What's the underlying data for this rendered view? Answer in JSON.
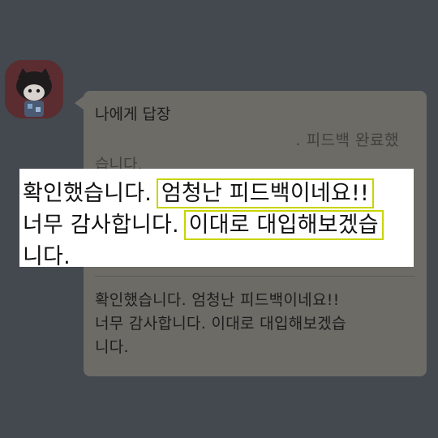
{
  "chat": {
    "reply_title": "나에게 답장",
    "quoted_line1": ". 피드백 완료했",
    "quoted_line2": "습니다.",
    "reply_lines": [
      "확인했습니다. 엄청난 피드백이네요!!",
      "너무 감사합니다. 이대로 대입해보겠습",
      "니다."
    ]
  },
  "zoom": {
    "line1_plain": "확인했습니다.",
    "line1_highlight": "엄청난 피드백이네요!!",
    "line2_plain": "너무 감사합니다.",
    "line2_highlight": "이대로 대입해보겠습",
    "line3_plain": "니다."
  },
  "colors": {
    "background": "#44484f",
    "bubble": "#6c6b66",
    "highlight_box": "#c8d400",
    "zoom_panel": "#ffffff"
  }
}
